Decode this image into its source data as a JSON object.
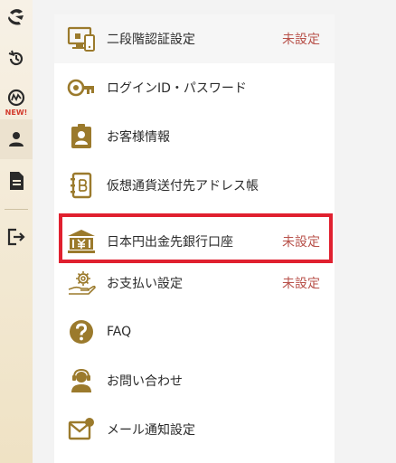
{
  "sidebar": {
    "new_badge": "NEW!"
  },
  "menu": {
    "items": [
      {
        "label": "二段階認証設定",
        "status": "未設定",
        "icon": "two-factor-device-icon"
      },
      {
        "label": "ログインID・パスワード",
        "status": "",
        "icon": "key-icon"
      },
      {
        "label": "お客様情報",
        "status": "",
        "icon": "customer-id-badge-icon"
      },
      {
        "label": "仮想通貨送付先アドレス帳",
        "status": "",
        "icon": "address-book-icon"
      },
      {
        "label": "日本円出金先銀行口座",
        "status": "未設定",
        "icon": "bank-icon"
      },
      {
        "label": "お支払い設定",
        "status": "未設定",
        "icon": "payment-gear-icon"
      },
      {
        "label": "FAQ",
        "status": "",
        "icon": "question-icon"
      },
      {
        "label": "お問い合わせ",
        "status": "",
        "icon": "support-headset-icon"
      },
      {
        "label": "メール通知設定",
        "status": "",
        "icon": "mail-notification-icon"
      }
    ]
  },
  "colors": {
    "icon_gold": "#9b7a2c",
    "status_red": "#b8514a",
    "highlight_red": "#e0202f",
    "sidebar_dark": "#2a2a2a"
  }
}
